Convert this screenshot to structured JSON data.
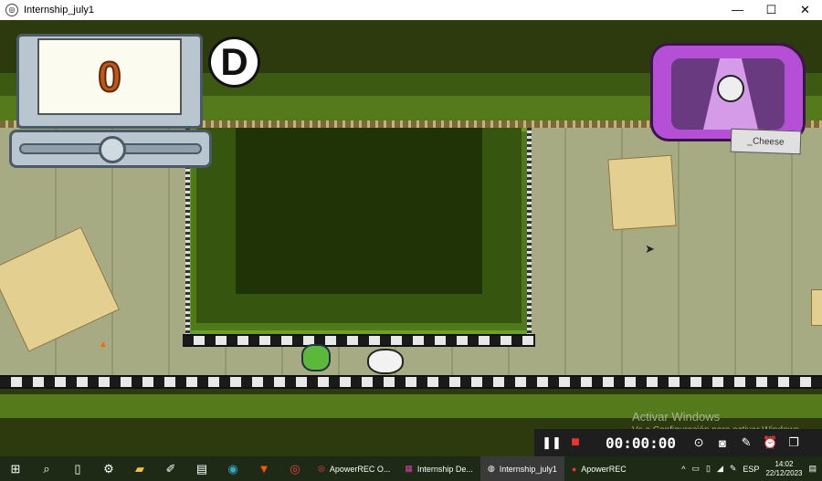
{
  "window": {
    "title": "Internship_july1",
    "minimize": "—",
    "maximize": "☐",
    "close": "✕"
  },
  "game": {
    "score": "0",
    "grade": "D",
    "tv_sign": "_Cheese",
    "colors": {
      "wall": "#a7ab83",
      "pit": "#1f3306",
      "tv": "#b44fd6",
      "score": "#c0561a"
    }
  },
  "watermark": {
    "title": "Activar Windows",
    "subtitle": "Ve a Configuración para activar Windows."
  },
  "recorder": {
    "timer": "00:00:00",
    "pause": "❚❚",
    "stop": "■",
    "icons": [
      "screenshot-region-icon",
      "camera-icon",
      "pen-icon",
      "alarm-icon",
      "window-icon"
    ]
  },
  "taskbar": {
    "apps": [
      {
        "label": "ApowerREC O...",
        "active": false
      },
      {
        "label": "Internship De...",
        "active": false
      },
      {
        "label": "Internship_july1",
        "active": true
      },
      {
        "label": "ApowerREC",
        "active": false
      }
    ],
    "lang": "ESP",
    "time": "14:02",
    "date": "22/12/2023"
  }
}
